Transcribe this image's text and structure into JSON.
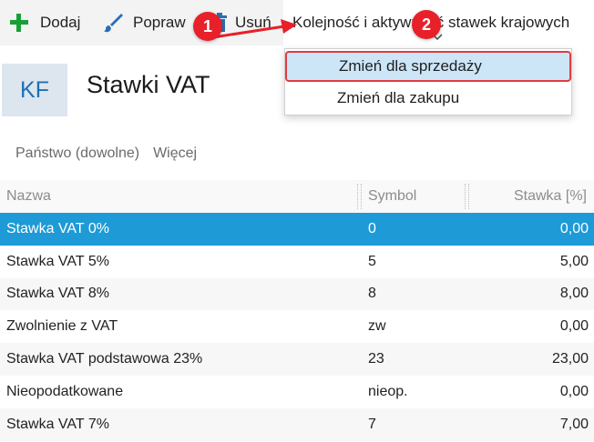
{
  "toolbar": {
    "add_label": "Dodaj",
    "edit_label": "Popraw",
    "delete_label": "Usuń",
    "order_label": "Kolejność i aktywność stawek krajowych"
  },
  "callouts": {
    "one": "1",
    "two": "2"
  },
  "dropdown": {
    "items": [
      {
        "label": "Zmień dla sprzedaży"
      },
      {
        "label": "Zmień dla zakupu"
      }
    ]
  },
  "header": {
    "badge": "KF",
    "title": "Stawki VAT"
  },
  "filters": {
    "country": "Państwo (dowolne)",
    "more": "Więcej"
  },
  "table": {
    "columns": {
      "name": "Nazwa",
      "symbol": "Symbol",
      "rate": "Stawka [%]"
    },
    "rows": [
      {
        "name": "Stawka VAT 0%",
        "symbol": "0",
        "rate": "0,00"
      },
      {
        "name": "Stawka VAT 5%",
        "symbol": "5",
        "rate": "5,00"
      },
      {
        "name": "Stawka VAT 8%",
        "symbol": "8",
        "rate": "8,00"
      },
      {
        "name": "Zwolnienie z VAT",
        "symbol": "zw",
        "rate": "0,00"
      },
      {
        "name": "Stawka VAT podstawowa 23%",
        "symbol": "23",
        "rate": "23,00"
      },
      {
        "name": "Nieopodatkowane",
        "symbol": "nieop.",
        "rate": "0,00"
      },
      {
        "name": "Stawka VAT 7%",
        "symbol": "7",
        "rate": "7,00"
      }
    ]
  },
  "colors": {
    "accent_green": "#16a036",
    "selection_blue": "#1e9ad6",
    "callout_red": "#e8202a",
    "brand_blue": "#1f6fb2"
  }
}
